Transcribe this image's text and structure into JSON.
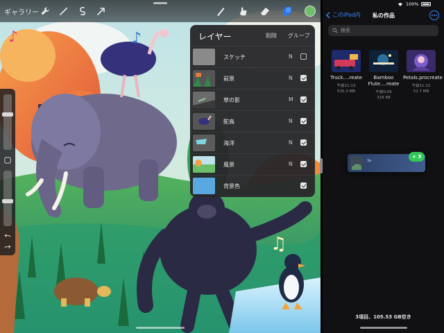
{
  "procreate": {
    "toolbar": {
      "gallery_label": "ギャラリー",
      "left_icons": [
        "wrench-icon",
        "magic-wand-icon",
        "selection-icon",
        "transform-arrow-icon"
      ],
      "right_icons": [
        "brush-icon",
        "smudge-icon",
        "eraser-icon",
        "layers-icon"
      ],
      "color": "#6fbf6a"
    },
    "layers_panel": {
      "title": "レイヤー",
      "delete_label": "削除",
      "group_label": "グループ",
      "layers": [
        {
          "name": "スケッチ",
          "mode": "N",
          "visible": false
        },
        {
          "name": "前景",
          "mode": "N",
          "visible": true
        },
        {
          "name": "草の影",
          "mode": "M",
          "visible": true
        },
        {
          "name": "駝鳥",
          "mode": "N",
          "visible": true
        },
        {
          "name": "海洋",
          "mode": "N",
          "visible": true
        },
        {
          "name": "風景",
          "mode": "N",
          "visible": true
        },
        {
          "name": "背景色",
          "mode": "",
          "visible": true
        }
      ]
    },
    "sidebar": {
      "brush_size_level": 0.65,
      "opacity_level": 0.45
    }
  },
  "files": {
    "status": {
      "battery_percent": "100%"
    },
    "nav": {
      "back_label": "このiPad内",
      "title": "私の作品"
    },
    "search": {
      "placeholder": "検索"
    },
    "items": [
      {
        "name": "Truck....reate",
        "date": "午前11:13",
        "size": "535.3 MB"
      },
      {
        "name": "Bamboo Flute....reate",
        "date": "午前0:09",
        "size": "316 KB"
      },
      {
        "name": "Petals.procreate",
        "date": "午前11:12",
        "size": "51.7 MB"
      }
    ],
    "drag": {
      "label": "3a",
      "badge": "3"
    },
    "footer": "3項目、105.53 GB空き"
  }
}
